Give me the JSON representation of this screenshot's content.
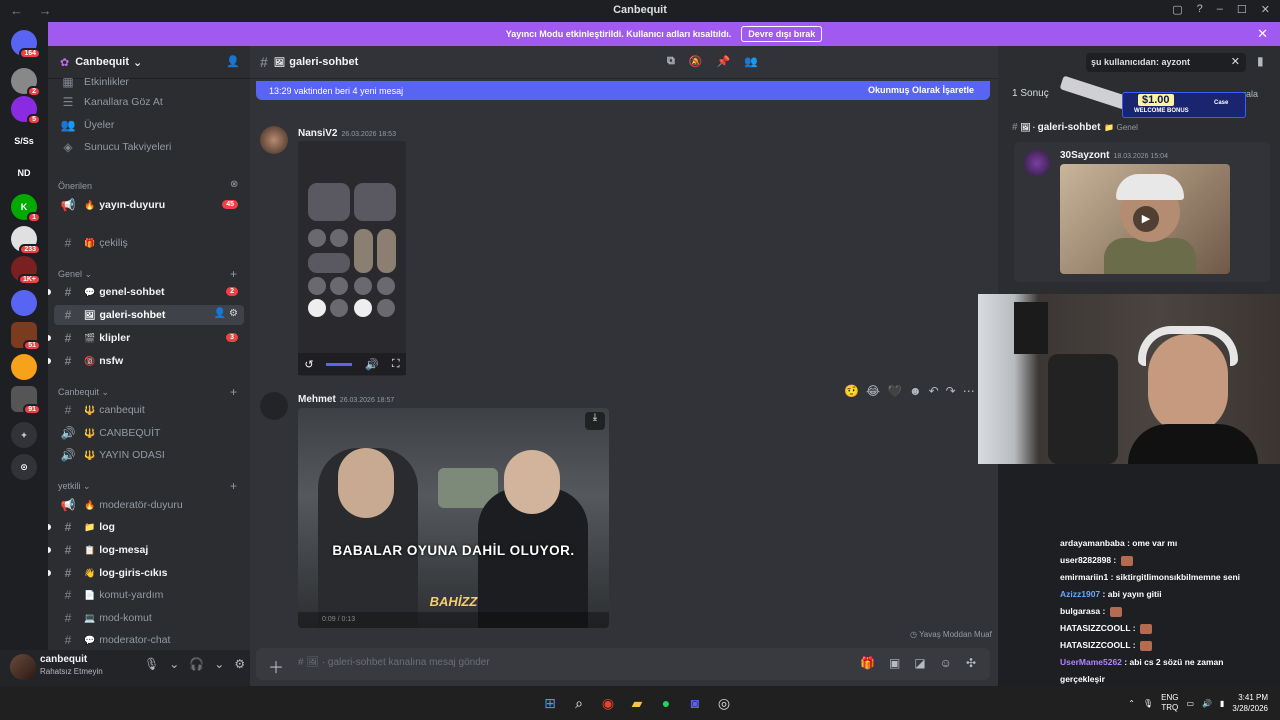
{
  "window": {
    "title": "Canbequit",
    "nav_arrows": "←  →",
    "controls": [
      "▢",
      "?",
      "–",
      "☐",
      "✕"
    ]
  },
  "banner": {
    "text": "Yayıncı Modu etkinleştirildi. Kullanıcı adları kısaltıldı.",
    "button": "Devre dışı bırak"
  },
  "rail": {
    "servers": [
      {
        "label": "",
        "badge": "164",
        "color": "#5865f2"
      },
      {
        "label": "",
        "badge": "2",
        "color": "#888"
      },
      {
        "label": "",
        "badge": "5",
        "color": "#8a2be2"
      },
      {
        "label": "S/Ss",
        "badge": "",
        "color": "#1e1f22"
      },
      {
        "label": "ND",
        "badge": "",
        "color": "#1e1f22"
      },
      {
        "label": "K",
        "badge": "1",
        "color": "#0a0"
      },
      {
        "label": "",
        "badge": "233",
        "color": "#e0e0e0"
      },
      {
        "label": "",
        "badge": "1K+",
        "color": "#7a2020"
      },
      {
        "label": "",
        "badge": "",
        "color": "#5865f2"
      },
      {
        "label": "",
        "badge": "51",
        "color": "#7a3b1f"
      },
      {
        "label": "",
        "badge": "",
        "color": "#f7a21b"
      },
      {
        "label": "",
        "badge": "91",
        "color": "#555"
      },
      {
        "label": "+",
        "badge": "",
        "color": "#313338"
      },
      {
        "label": "⊙",
        "badge": "",
        "color": "#313338"
      }
    ]
  },
  "server": {
    "name": "Canbequit",
    "top_items": [
      "Etkinlikler",
      "Kanallara Göz At",
      "Üyeler",
      "Sunucu Takviyeleri"
    ],
    "categories": {
      "suggested": "Önerilen",
      "general": "Genel",
      "canbequit": "Canbequit",
      "staff": "yetkili"
    },
    "channels": {
      "yayin_duyuru": {
        "name": "yayın-duyuru",
        "count": "45"
      },
      "cekilis": {
        "name": "çekiliş"
      },
      "genel_sohbet": {
        "name": "genel-sohbet",
        "count": "2"
      },
      "galeri_sohbet": {
        "name": "galeri-sohbet"
      },
      "klipler": {
        "name": "klipler",
        "count": "3"
      },
      "nsfw": {
        "name": "nsfw"
      },
      "canbequit_text": {
        "name": "canbequit"
      },
      "canbequit_voice": {
        "name": "CANBEQUİT"
      },
      "yayin_odasi": {
        "name": "YAYIN ODASI"
      },
      "moderator_duyuru": {
        "name": "moderatör-duyuru"
      },
      "log": {
        "name": "log"
      },
      "log_mesaj": {
        "name": "log-mesaj"
      },
      "log_giris": {
        "name": "log-giris-cıkıs"
      },
      "komut_yardim": {
        "name": "komut-yardım"
      },
      "mod_komut": {
        "name": "mod-komut"
      },
      "moderator_chat": {
        "name": "moderator-chat"
      }
    }
  },
  "user": {
    "name": "canbequit",
    "status": "Rahatsız Etmeyin"
  },
  "chat": {
    "channel": "galeri-sohbet",
    "new_messages": "13:29 vaktinden beri 4 yeni mesaj",
    "mark_read": "Okunmuş Olarak İşaretle",
    "messages": [
      {
        "author": "NansiV2",
        "time": "26.03.2026 18:53"
      },
      {
        "author": "Mehmet",
        "time": "26.03.2026 18:57",
        "subtitle": "BABALAR OYUNA DAHİL OLUYOR.",
        "watermark": "BAHİZZ",
        "video_time": "0:09 / 0:13"
      }
    ],
    "slowmode": "Yavaş Moddan Muaf",
    "composer_placeholder": "galeri-sohbet kanalına mesaj gönder"
  },
  "search": {
    "query": "şu kullanıcıdan: ayzont",
    "result_count": "1 Sonuç",
    "sort_label": "rala",
    "result_channel": "galeri-sohbet",
    "result_category": "Genel",
    "result_author": "30Sayzont",
    "result_time": "18.03.2026 15:04"
  },
  "promo": {
    "amount": "$1.00",
    "text": "WELCOME BONUS",
    "brand": "Case"
  },
  "twitch_chat": [
    {
      "user": "ardayamanbaba",
      "color": "#ffffff",
      "msg": "ome var mı",
      "emote": false
    },
    {
      "user": "user8282898",
      "color": "#ffffff",
      "msg": "",
      "emote": true
    },
    {
      "user": "emirmariin1",
      "color": "#ffffff",
      "msg": "siktirgitlimonsıkbilmemne seni",
      "emote": false
    },
    {
      "user": "Azizz1907",
      "color": "#6aa8ff",
      "msg": "abi yayın gitii",
      "emote": false
    },
    {
      "user": "bulgarasa",
      "color": "#ffffff",
      "msg": "",
      "emote": true
    },
    {
      "user": "HATASIZZCOOLL",
      "color": "#ffffff",
      "msg": "",
      "emote": true
    },
    {
      "user": "HATASIZZCOOLL",
      "color": "#ffffff",
      "msg": "",
      "emote": true
    },
    {
      "user": "UserMame5262",
      "color": "#b084ff",
      "msg": "abi cs 2 sözü ne zaman",
      "emote": false
    },
    {
      "user": "",
      "color": "#ffffff",
      "msg": "gerçekleşir",
      "emote": false
    },
    {
      "user": "bulgarasa",
      "color": "#ffffff",
      "msg": "",
      "emote": true
    },
    {
      "user": "bulgarasa",
      "color": "#ffffff",
      "msg": "",
      "emote": true
    }
  ],
  "taskbar": {
    "lang_top": "ENG",
    "lang_bottom": "TRQ",
    "time": "3:41 PM",
    "date": "3/28/2026"
  }
}
